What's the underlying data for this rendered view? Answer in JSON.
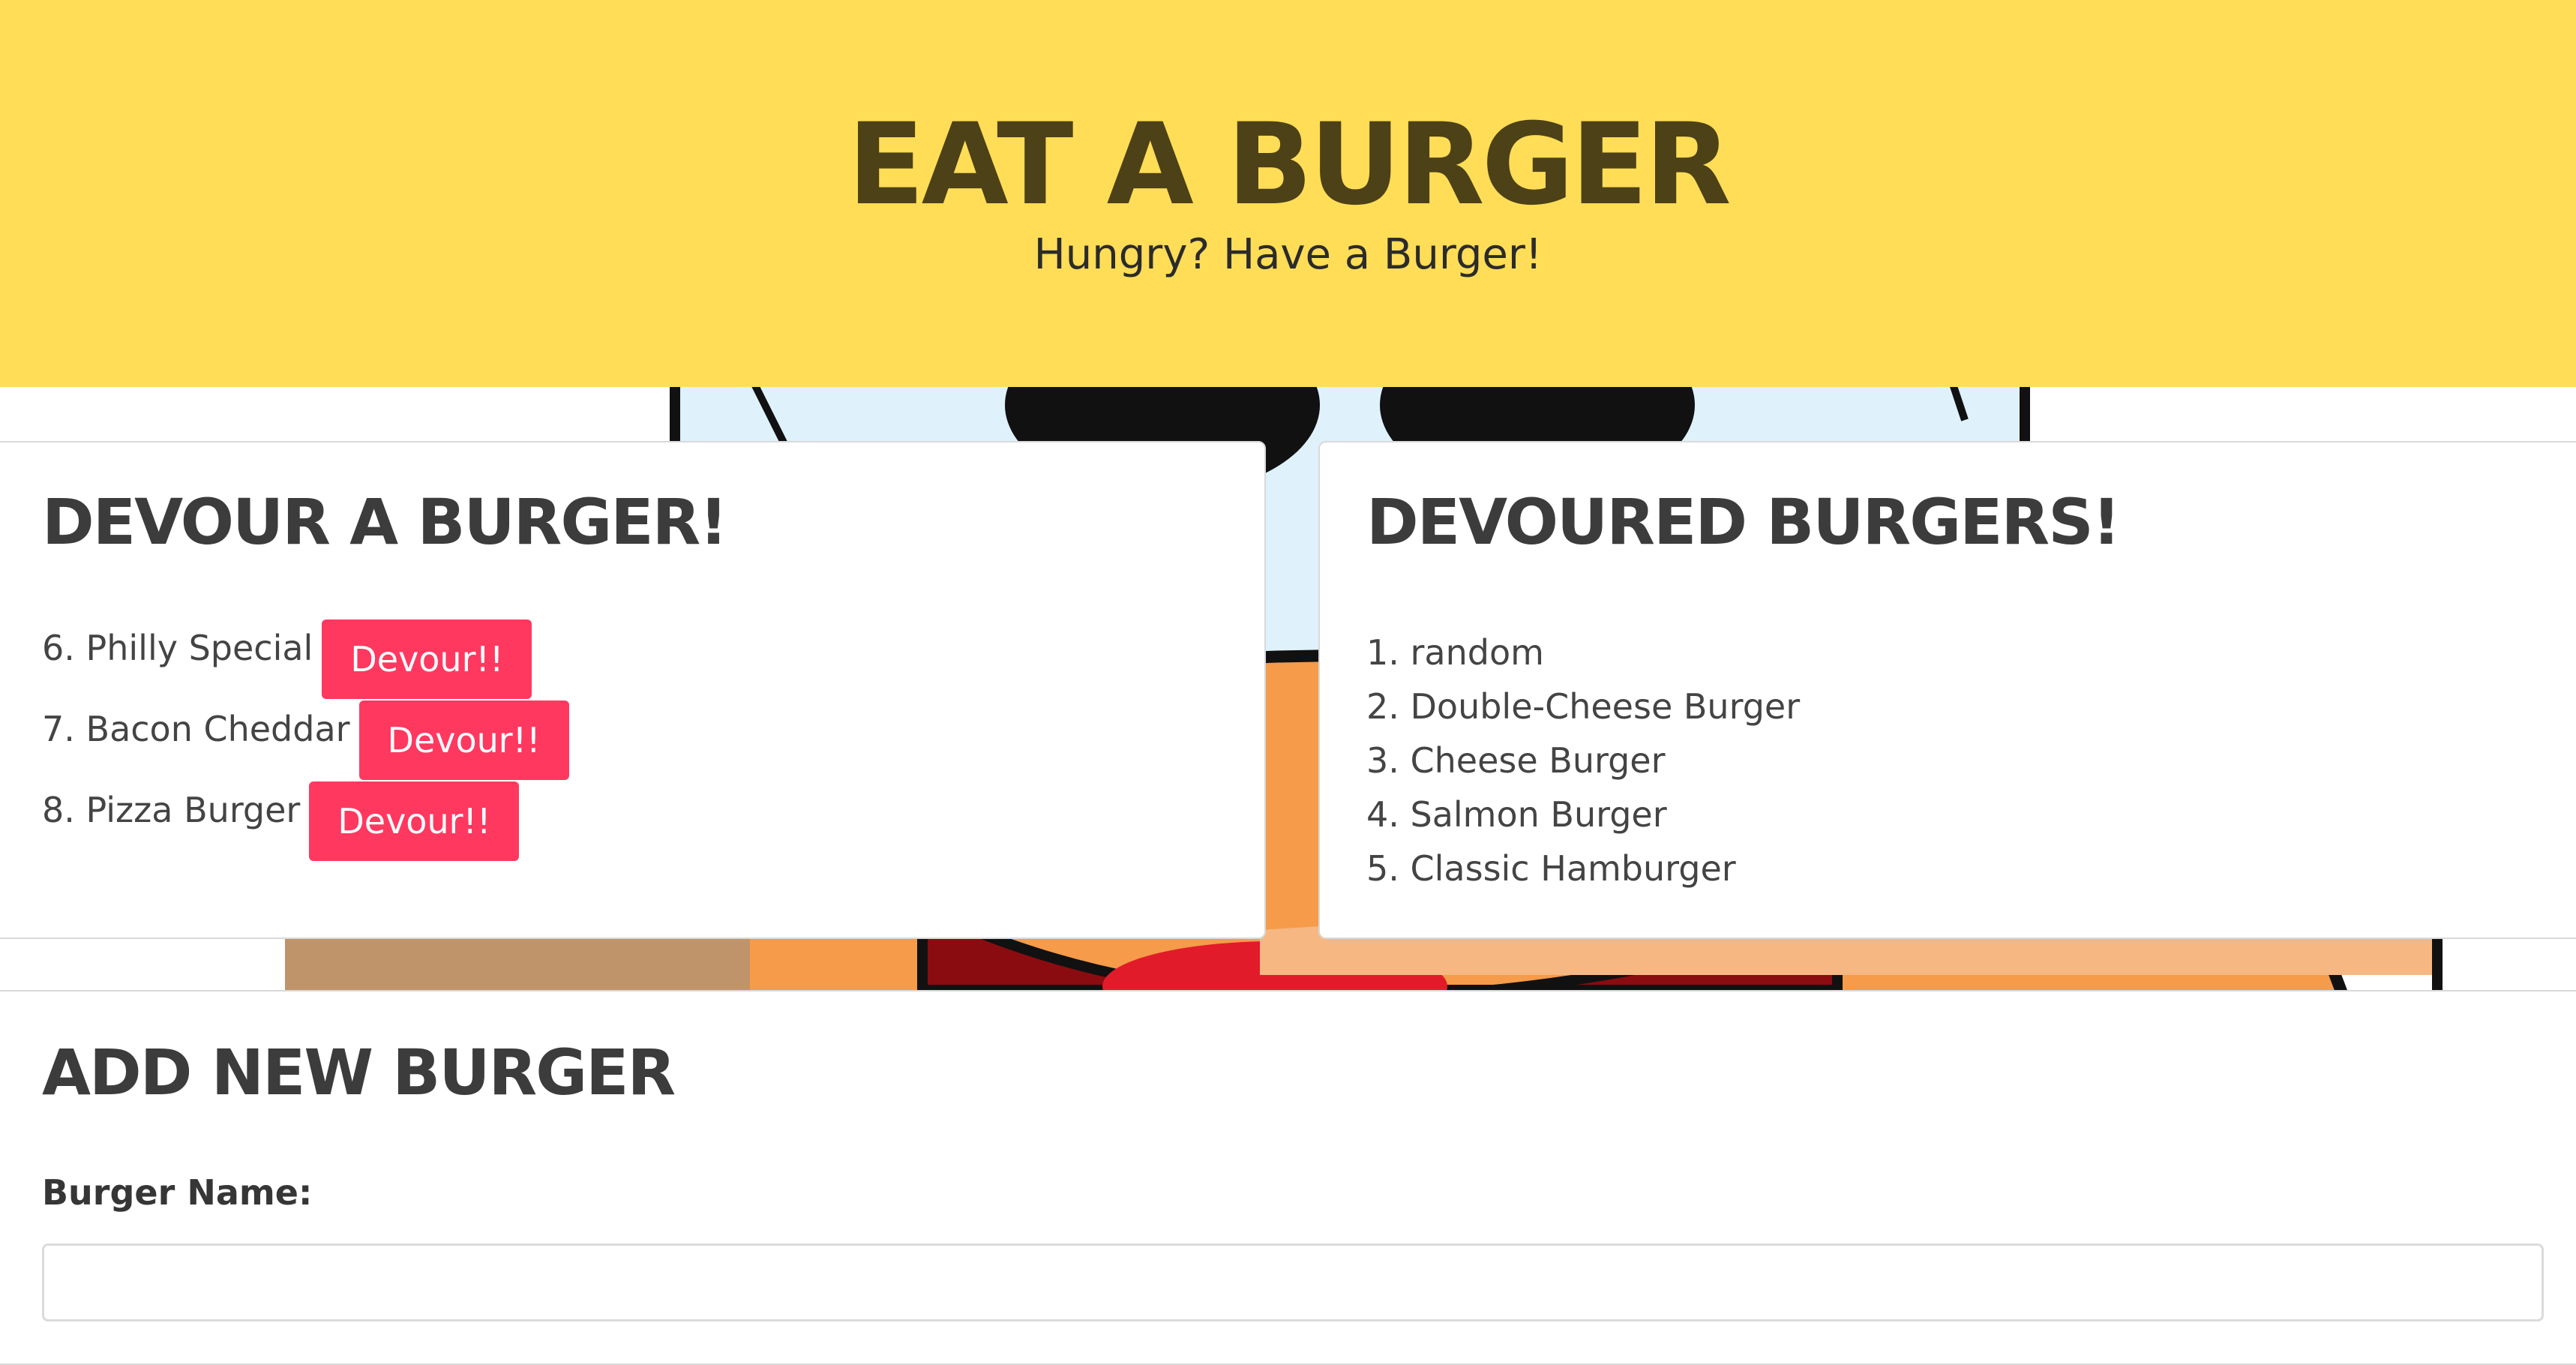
{
  "header": {
    "title": "EAT A BURGER",
    "subtitle": "Hungry? Have a Burger!"
  },
  "devour_card": {
    "title": "DEVOUR A BURGER!",
    "items": [
      {
        "label": "6. Philly Special",
        "button_label": "Devour!!"
      },
      {
        "label": "7. Bacon Cheddar",
        "button_label": "Devour!!"
      },
      {
        "label": "8. Pizza Burger",
        "button_label": "Devour!!"
      }
    ]
  },
  "devoured_card": {
    "title": "DEVOURED BURGERS!",
    "items": [
      "1. random",
      "2. Double-Cheese Burger",
      "3. Cheese Burger",
      "4. Salmon Burger",
      "5. Classic Hamburger"
    ]
  },
  "add_card": {
    "title": "ADD NEW BURGER",
    "field_label": "Burger Name:",
    "input_value": "",
    "input_placeholder": ""
  },
  "colors": {
    "header_bg": "#ffdd57",
    "title_color": "#4d4117",
    "button_bg": "#ff3860",
    "button_text": "#ffffff",
    "card_bg": "#ffffff"
  },
  "icons": {
    "background": "burger-mascot-illustration"
  }
}
